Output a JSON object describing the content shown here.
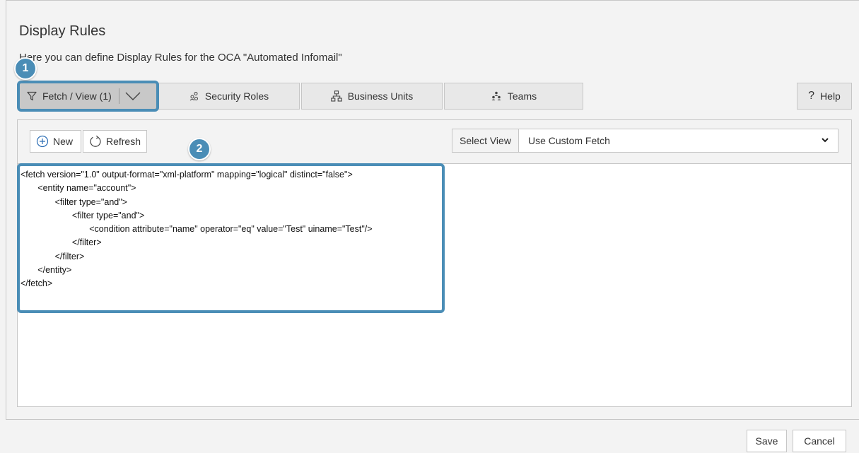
{
  "header": {
    "title": "Display Rules",
    "subtitle": "Here you can define Display Rules for the OCA \"Automated Infomail\""
  },
  "tabs": [
    {
      "label": "Fetch / View (1)",
      "icon": "filter-icon",
      "active": true
    },
    {
      "label": "Security Roles",
      "icon": "security-roles-icon"
    },
    {
      "label": "Business Units",
      "icon": "hierarchy-icon"
    },
    {
      "label": "Teams",
      "icon": "teams-icon"
    }
  ],
  "help": {
    "label": "Help",
    "icon": "question-icon"
  },
  "toolbar": {
    "new_label": "New",
    "refresh_label": "Refresh",
    "select_view_label": "Select View",
    "select_view_value": "Use Custom Fetch"
  },
  "fetch_xml": "<fetch version=\"1.0\" output-format=\"xml-platform\" mapping=\"logical\" distinct=\"false\">\n       <entity name=\"account\">\n              <filter type=\"and\">\n                     <filter type=\"and\">\n                            <condition attribute=\"name\" operator=\"eq\" value=\"Test\" uiname=\"Test\"/>\n                     </filter>\n              </filter>\n       </entity>\n</fetch>",
  "callouts": [
    "1",
    "2"
  ],
  "footer": {
    "save_label": "Save",
    "cancel_label": "Cancel"
  },
  "colors": {
    "callout": "#4a8db6",
    "active_tab": "#c8c8c8",
    "tab": "#e8e8e8",
    "background": "#f3f3f3"
  }
}
